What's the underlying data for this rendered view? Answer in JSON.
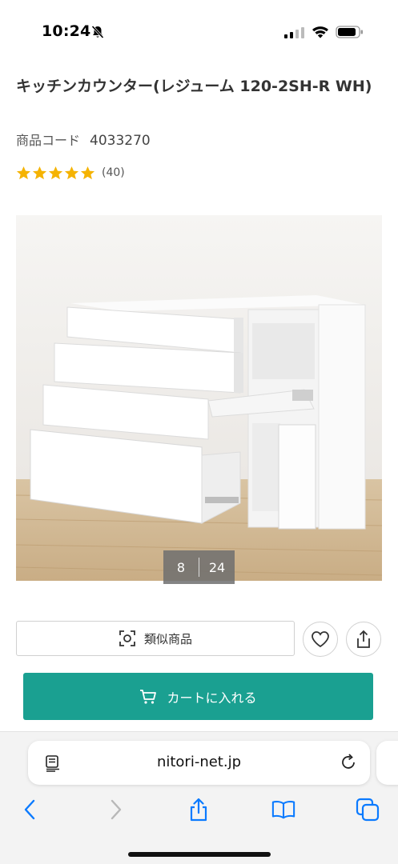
{
  "status_bar": {
    "time": "10:24",
    "icons": [
      "bell-slash-icon",
      "signal-icon",
      "wifi-icon",
      "battery-icon"
    ]
  },
  "product": {
    "title": "キッチンカウンター(レジューム 120-2SH-R WH)",
    "code_label": "商品コード",
    "code_value": "4033270",
    "rating_stars": 5,
    "rating_value": 5,
    "review_count": "(40)",
    "star_color": "#f5b301"
  },
  "gallery": {
    "current": "8",
    "total": "24"
  },
  "actions": {
    "similar_label": "類似商品",
    "similar_icon": "image-search-icon",
    "favorite_icon": "heart-icon",
    "share_icon": "share-icon",
    "cart_label": "カートに入れる",
    "cart_icon": "cart-icon",
    "cart_color": "#1aa091"
  },
  "browser": {
    "url": "nitori-net.jp",
    "toolbar_icons": [
      "back-icon",
      "forward-icon",
      "share-icon",
      "bookmarks-icon",
      "tabs-icon"
    ],
    "accent": "#0a7aff"
  }
}
